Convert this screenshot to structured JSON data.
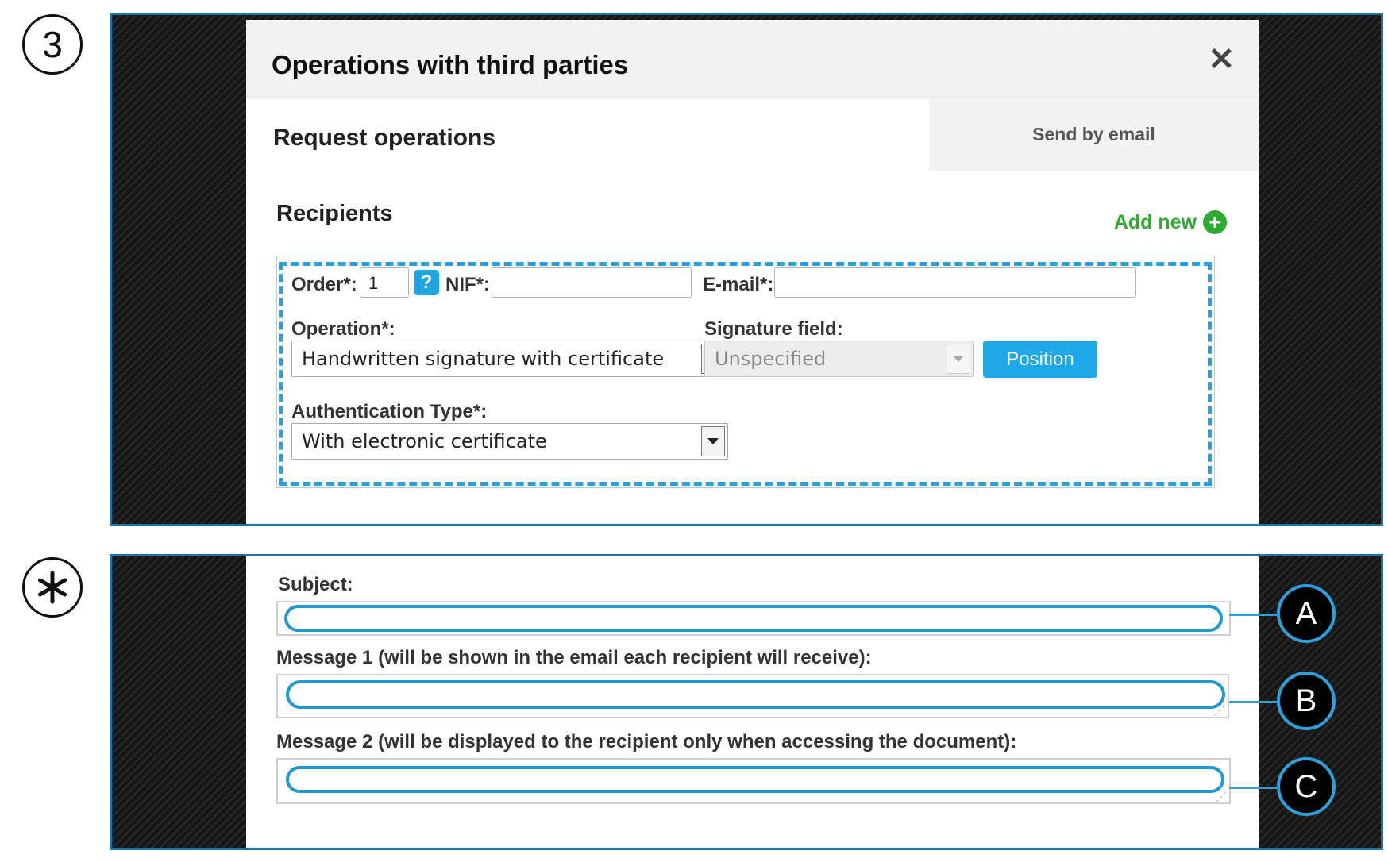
{
  "step_marker": "3",
  "step_marker_2": "asterisk",
  "dialog": {
    "title": "Operations with third parties",
    "close_glyph": "✕",
    "tabs": {
      "request": "Request operations",
      "email": "Send by email"
    },
    "recipients": {
      "title": "Recipients",
      "add_new": "Add new",
      "order_label": "Order*:",
      "order_value": "1",
      "help_glyph": "?",
      "nif_label": "NIF*:",
      "nif_value": "",
      "email_label": "E-mail*:",
      "email_value": "",
      "operation_label": "Operation*:",
      "operation_value": "Handwritten signature with certificate",
      "signature_field_label": "Signature field:",
      "signature_field_value": "Unspecified",
      "position_button": "Position",
      "auth_type_label": "Authentication Type*:",
      "auth_type_value": "With electronic certificate"
    }
  },
  "email_form": {
    "subject_label": "Subject:",
    "message1_label": "Message 1 (will be shown in the email each recipient will receive):",
    "message2_label": "Message 2 (will be displayed to the recipient only when accessing the document):",
    "callouts": [
      "A",
      "B",
      "C"
    ]
  },
  "colors": {
    "frame_border": "#1e73a8",
    "highlight_blue": "#2ca0dc",
    "add_green": "#2eaa2e",
    "position_button": "#1ea8e8"
  },
  "icons": {
    "close": "close-icon",
    "help": "help-icon",
    "add": "plus-circle-icon",
    "dropdown": "chevron-down-icon",
    "asterisk": "asterisk-icon"
  }
}
